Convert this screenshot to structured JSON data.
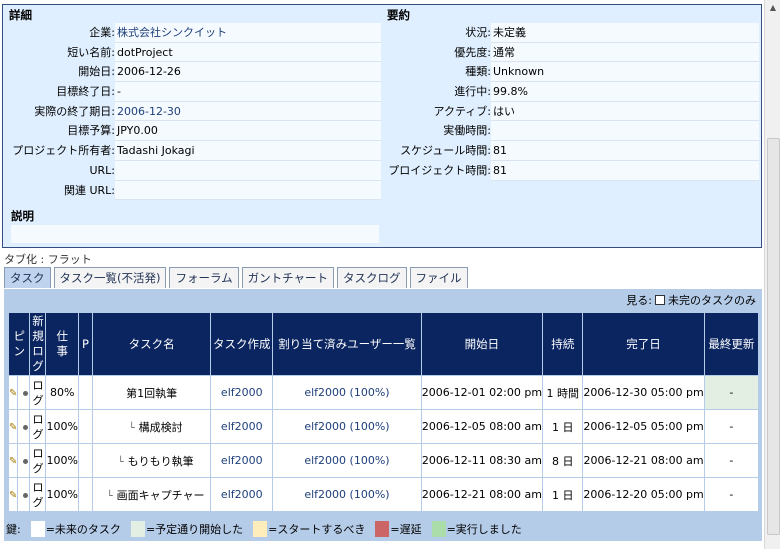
{
  "details": {
    "title": "詳細",
    "fields": [
      {
        "label": "企業:",
        "value": "株式会社シンクイット",
        "link": true
      },
      {
        "label": "短い名前:",
        "value": "dotProject",
        "link": false
      },
      {
        "label": "開始日:",
        "value": "2006-12-26",
        "link": false
      },
      {
        "label": "目標終了日:",
        "value": "-",
        "link": false
      },
      {
        "label": "実際の終了期日:",
        "value": "2006-12-30",
        "link": true
      },
      {
        "label": "目標予算:",
        "value": "JPY0.00",
        "link": false
      },
      {
        "label": "プロジェクト所有者:",
        "value": "Tadashi Jokagi",
        "link": false
      },
      {
        "label": "URL:",
        "value": "",
        "link": false
      },
      {
        "label": "関連 URL:",
        "value": "",
        "link": false
      }
    ],
    "description_title": "説明",
    "description": ""
  },
  "summary": {
    "title": "要約",
    "fields": [
      {
        "label": "状況:",
        "value": "未定義"
      },
      {
        "label": "優先度:",
        "value": "通常"
      },
      {
        "label": "種類:",
        "value": "Unknown"
      },
      {
        "label": "進行中:",
        "value": "99.8%"
      },
      {
        "label": "アクティブ:",
        "value": "はい"
      },
      {
        "label": "実働時間:",
        "value": ""
      },
      {
        "label": "スケジュール時間:",
        "value": "81"
      },
      {
        "label": "プロイジェクト時間:",
        "value": "81"
      }
    ]
  },
  "tab_view_label": "タブ化 : フラット",
  "tabs": [
    "タスク",
    "タスク一覧(不活発)",
    "フォーラム",
    "ガントチャート",
    "タスクログ",
    "ファイル"
  ],
  "filter_label": "見る:",
  "filter_option": "未完のタスクのみ",
  "table": {
    "headers": {
      "pin": "ピン",
      "newlog": "新規ログ",
      "work": "仕事",
      "p": "P",
      "name": "タスク名",
      "creator": "タスク作成",
      "assigned": "割り当て済みユーザー一覧",
      "start": "開始日",
      "duration": "持続",
      "end": "完了日",
      "updated": "最終更新"
    },
    "rows": [
      {
        "log": "ログ",
        "work": "80%",
        "name": "第1回執筆",
        "creator": "elf2000",
        "assigned": "elf2000 (100%)",
        "start": "2006-12-01 02:00 pm",
        "duration": "1 時間",
        "end": "2006-12-30 05:00 pm",
        "updated": "-"
      },
      {
        "log": "ログ",
        "work": "100%",
        "name": "構成検討",
        "creator": "elf2000",
        "assigned": "elf2000 (100%)",
        "start": "2006-12-05 08:00 am",
        "duration": "1 日",
        "end": "2006-12-05 05:00 pm",
        "updated": "-"
      },
      {
        "log": "ログ",
        "work": "100%",
        "name": "もりもり執筆",
        "creator": "elf2000",
        "assigned": "elf2000 (100%)",
        "start": "2006-12-11 08:30 am",
        "duration": "8 日",
        "end": "2006-12-21 08:00 am",
        "updated": "-"
      },
      {
        "log": "ログ",
        "work": "100%",
        "name": "画面キャプチャー",
        "creator": "elf2000",
        "assigned": "elf2000 (100%)",
        "start": "2006-12-21 08:00 am",
        "duration": "1 日",
        "end": "2006-12-20 05:00 pm",
        "updated": "-"
      }
    ]
  },
  "legend": {
    "label": "鍵:",
    "items": [
      {
        "text": "=未来のタスク",
        "color": "#ffffff"
      },
      {
        "text": "=予定通り開始した",
        "color": "#e4efe3"
      },
      {
        "text": "=スタートするべき",
        "color": "#ffeebb"
      },
      {
        "text": "=遅延",
        "color": "#cc6666"
      },
      {
        "text": "=実行しました",
        "color": "#aaddaa"
      }
    ]
  }
}
